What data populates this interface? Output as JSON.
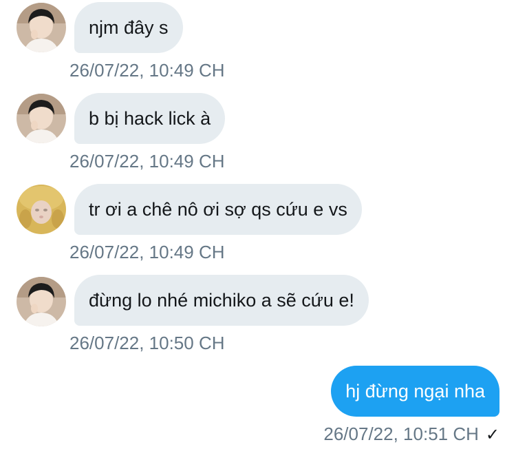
{
  "messages": [
    {
      "sender": "received",
      "avatar": "boy-avatar",
      "text": "njm đây s",
      "time": "26/07/22, 10:49 CH"
    },
    {
      "sender": "received",
      "avatar": "boy-avatar",
      "text": "b bị hack lick à",
      "time": "26/07/22, 10:49 CH"
    },
    {
      "sender": "received",
      "avatar": "blurred-face-avatar",
      "text": "tr ơi a chê nô ơi sợ qs cứu e vs",
      "time": "26/07/22, 10:49 CH"
    },
    {
      "sender": "received",
      "avatar": "boy-avatar",
      "text": "đừng lo nhé michiko a sẽ cứu e!",
      "time": "26/07/22, 10:50 CH"
    },
    {
      "sender": "sent",
      "text": "hj đừng ngại nha",
      "time": "26/07/22, 10:51 CH",
      "status_icon": "check-icon",
      "status_glyph": "✓"
    }
  ],
  "colors": {
    "received_bubble": "#e6ecf0",
    "sent_bubble": "#1da1f2",
    "timestamp": "#657786",
    "text": "#14171a"
  }
}
